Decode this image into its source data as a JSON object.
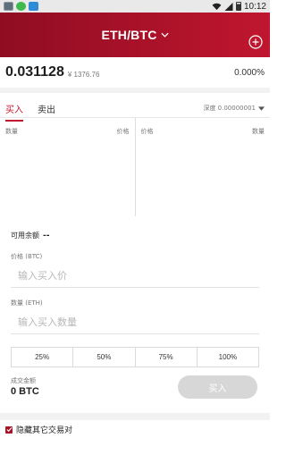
{
  "status_bar": {
    "time": "10:12"
  },
  "header": {
    "pair_base": "ETH",
    "pair_sep": "/",
    "pair_quote": "BTC"
  },
  "ticker": {
    "price": "0.031128",
    "price_cny": "¥ 1376.76",
    "change": "0.000%"
  },
  "tabs": [
    {
      "label": "买入",
      "active": true
    },
    {
      "label": "卖出",
      "active": false
    }
  ],
  "depth": {
    "label": "深度 0.00000001"
  },
  "order_book": {
    "left_headers": {
      "qty": "数量",
      "price": "价格"
    },
    "right_headers": {
      "price": "价格",
      "qty": "数量"
    }
  },
  "form": {
    "balance_label": "可用余额",
    "balance_value": "--",
    "price_label": "价格 (BTC)",
    "price_placeholder": "输入买入价",
    "qty_label": "数量 (ETH)",
    "qty_placeholder": "输入买入数量",
    "percent_options": [
      "25%",
      "50%",
      "75%",
      "100%"
    ],
    "amount_label": "成交金额",
    "amount_value": "0 BTC",
    "submit_label": "买入"
  },
  "footer": {
    "hide_others_label": "隐藏其它交易对",
    "hide_others_checked": true
  },
  "colors": {
    "brand_red": "#c21a30",
    "header_dark": "#8f0d22",
    "button_disabled": "#d7d7d7"
  }
}
